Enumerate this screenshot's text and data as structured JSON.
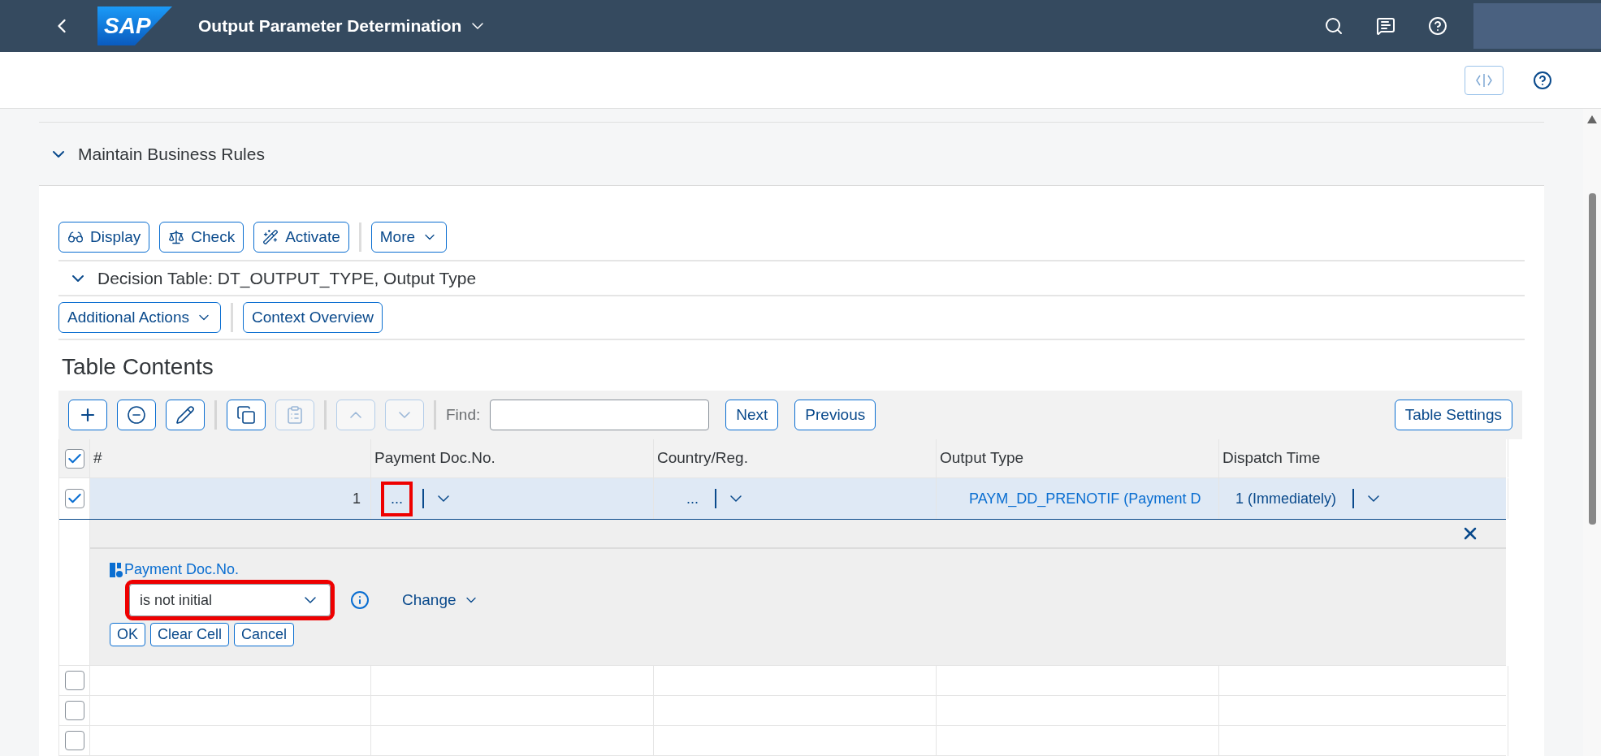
{
  "shell": {
    "title": "Output Parameter Determination",
    "logo": "SAP"
  },
  "section": {
    "title": "Maintain Business Rules",
    "expanded": true,
    "toolbar": [
      {
        "label": "Display",
        "kind": "glasses"
      },
      {
        "label": "Check",
        "kind": "scale"
      },
      {
        "label": "Activate",
        "kind": "wand"
      },
      {
        "label": "More",
        "kind": "menu"
      }
    ]
  },
  "decision_table": {
    "title": "Decision Table: DT_OUTPUT_TYPE, Output Type",
    "expanded": true,
    "actions": [
      {
        "label": "Additional Actions",
        "kind": "menu"
      },
      {
        "label": "Context Overview",
        "kind": "plain"
      }
    ]
  },
  "table": {
    "title": "Table Contents",
    "icon_buttons": [
      {
        "kind": "add",
        "disabled": false
      },
      {
        "kind": "remove",
        "disabled": false
      },
      {
        "kind": "edit",
        "disabled": false
      },
      {
        "kind": "copy",
        "disabled": false
      },
      {
        "kind": "paste",
        "disabled": true
      },
      {
        "kind": "up",
        "disabled": true
      },
      {
        "kind": "down",
        "disabled": true
      }
    ],
    "find": {
      "label": "Find:"
    },
    "buttons": [
      "Next",
      "Previous"
    ],
    "settings_button": "Table Settings",
    "select_all_checked": true,
    "columns": [
      "#",
      "Payment Doc.No.",
      "Country/Reg.",
      "Output Type",
      "Dispatch Time"
    ],
    "rows": [
      {
        "checked": true,
        "selected": true,
        "cells": [
          {
            "text": "1",
            "kind": "number",
            "highlighted": false
          },
          {
            "text": "...",
            "kind": "dropdown",
            "highlighted": true
          },
          {
            "text": "...",
            "kind": "dropdown",
            "highlighted": false
          },
          {
            "text": "PAYM_DD_PRENOTIF (Payment D",
            "kind": "link",
            "highlighted": false
          },
          {
            "text": "1 (Immediately)",
            "kind": "dropdown",
            "highlighted": false
          }
        ]
      },
      {
        "checked": false,
        "selected": false,
        "cells": []
      },
      {
        "checked": false,
        "selected": false,
        "cells": []
      },
      {
        "checked": false,
        "selected": false,
        "cells": []
      }
    ],
    "editor": {
      "field": "Payment Doc.No.",
      "operator": "is not initial",
      "operator_highlighted": true,
      "change": "Change",
      "buttons": [
        "OK",
        "Clear Cell",
        "Cancel"
      ]
    }
  }
}
